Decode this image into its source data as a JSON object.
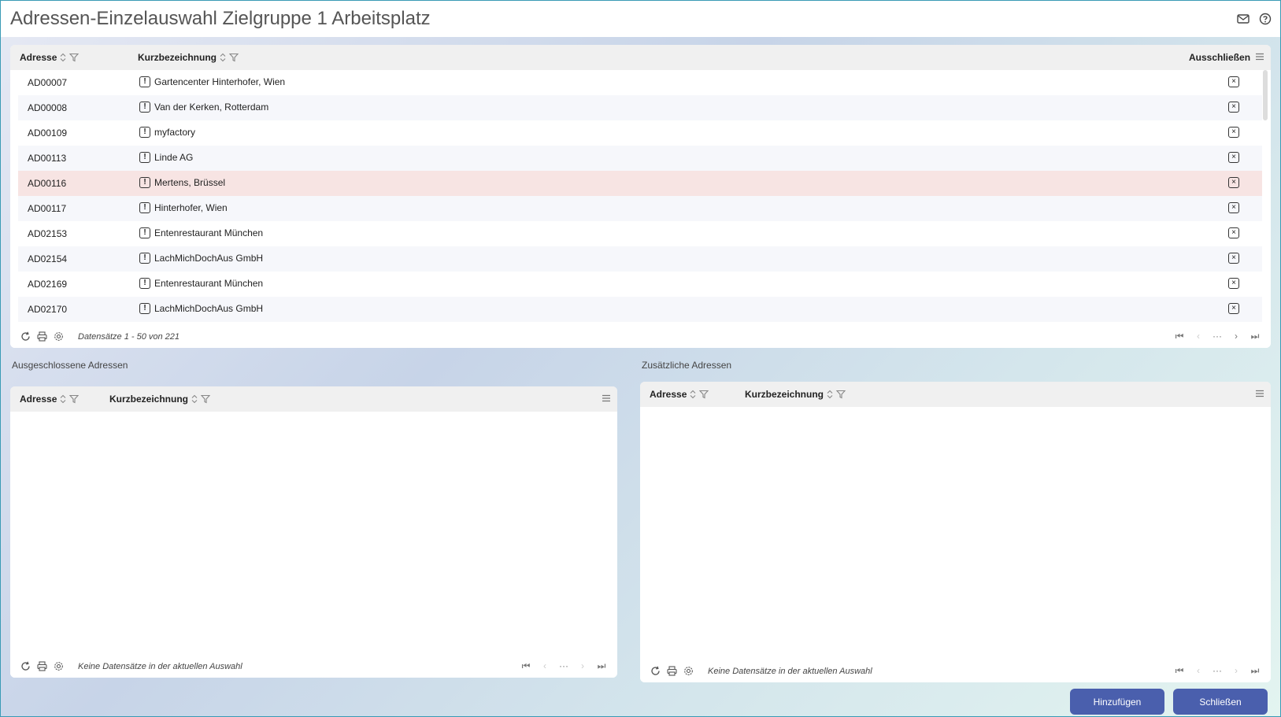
{
  "window": {
    "title": "Adressen-Einzelauswahl Zielgruppe 1 Arbeitsplatz"
  },
  "header_icons": [
    "mail-icon",
    "help-icon"
  ],
  "main_grid": {
    "columns": [
      "Adresse",
      "Kurzbezeichnung",
      "Ausschließen"
    ],
    "rows": [
      {
        "adresse": "AD00007",
        "kurz": "Gartencenter Hinterhofer, Wien"
      },
      {
        "adresse": "AD00008",
        "kurz": "Van der Kerken, Rotterdam"
      },
      {
        "adresse": "AD00109",
        "kurz": "myfactory"
      },
      {
        "adresse": "AD00113",
        "kurz": "Linde AG"
      },
      {
        "adresse": "AD00116",
        "kurz": "Mertens, Brüssel"
      },
      {
        "adresse": "AD00117",
        "kurz": "Hinterhofer, Wien"
      },
      {
        "adresse": "AD02153",
        "kurz": "Entenrestaurant München"
      },
      {
        "adresse": "AD02154",
        "kurz": "LachMichDochAus GmbH"
      },
      {
        "adresse": "AD02169",
        "kurz": "Entenrestaurant München"
      },
      {
        "adresse": "AD02170",
        "kurz": "LachMichDochAus GmbH"
      }
    ],
    "selected_index": 4,
    "status": "Datensätze 1 - 50 von 221"
  },
  "excluded": {
    "label": "Ausgeschlossene Adressen",
    "columns": [
      "Adresse",
      "Kurzbezeichnung"
    ],
    "status": "Keine Datensätze in der aktuellen Auswahl"
  },
  "additional": {
    "label": "Zusätzliche Adressen",
    "columns": [
      "Adresse",
      "Kurzbezeichnung"
    ],
    "status": "Keine Datensätze in der aktuellen Auswahl"
  },
  "buttons": {
    "add": "Hinzufügen",
    "close": "Schließen"
  },
  "colors": {
    "accent": "#4a5fad",
    "selected_row": "#f7e4e3"
  }
}
